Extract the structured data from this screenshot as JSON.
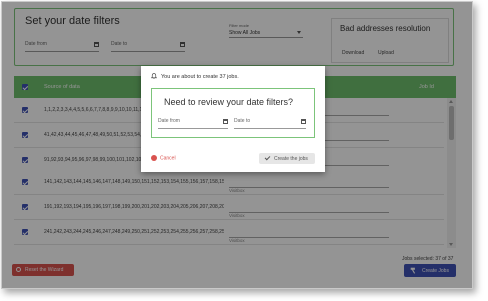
{
  "filters": {
    "title": "Set your date filters",
    "date_from_label": "Date from",
    "date_to_label": "Date to",
    "mode_label": "Filter mode",
    "mode_value": "Show All Jobs"
  },
  "bad_addresses": {
    "title": "Bad addresses resolution",
    "download": "Download",
    "upload": "Upload"
  },
  "table": {
    "col_source": "Source of data",
    "col_jobid": "Job Id",
    "visitbox_placeholder": "Visitbox",
    "rows": [
      "1,1,2,2,3,3,4,4,5,5,6,6,7,7,8,8,9,9,10,10,11,11,12,12,13",
      "41,42,43,44,45,46,47,48,49,50,51,52,53,54,55,56,57,58,59",
      "91,92,93,94,95,96,97,98,99,100,101,102,103,104,105,106",
      "141,142,143,144,145,146,147,148,149,150,151,152,153,154,155,156,157,158,159",
      "191,192,193,194,195,196,197,198,199,200,201,202,203,204,205,206,207,208,209",
      "241,242,243,244,245,246,247,248,249,250,251,252,253,254,255,256,257,258,259"
    ]
  },
  "footer": {
    "reset_label": "Reset the Wizard",
    "jobs_selected": "Jobs selected: 37 of 37",
    "create_label": "Create Jobs"
  },
  "modal": {
    "notice": "You are about to create 37 jobs.",
    "title": "Need to review your date filters?",
    "date_from_label": "Date from",
    "date_to_label": "Date to",
    "cancel_label": "Cancel",
    "create_label": "Create the jobs"
  },
  "colors": {
    "accent_green": "#6fc06d",
    "primary_blue": "#3f51b5",
    "danger_red": "#d9534f"
  }
}
